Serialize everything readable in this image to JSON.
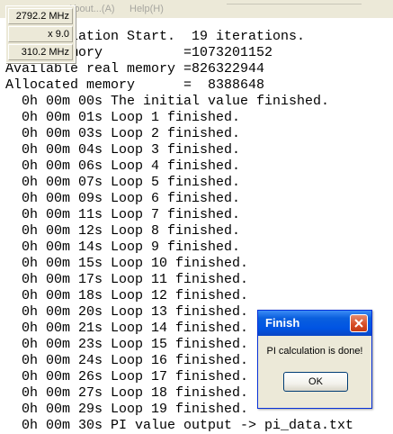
{
  "menubar": {
    "about_label": "About...(A)",
    "help_label": "Help(H)"
  },
  "cpu_meter": {
    "clock": "2792.2 MHz",
    "multiplier": "x 9.0",
    "bus": "310.2 MHz"
  },
  "console": {
    "lines": [
      "Pi calculation Start.  19 iterations.",
      "Total memory          =1073201152",
      "Available real memory =826322944",
      "Allocated memory      =  8388648",
      "  0h 00m 00s The initial value finished.",
      "  0h 00m 01s Loop 1 finished.",
      "  0h 00m 03s Loop 2 finished.",
      "  0h 00m 04s Loop 3 finished.",
      "  0h 00m 06s Loop 4 finished.",
      "  0h 00m 07s Loop 5 finished.",
      "  0h 00m 09s Loop 6 finished.",
      "  0h 00m 11s Loop 7 finished.",
      "  0h 00m 12s Loop 8 finished.",
      "  0h 00m 14s Loop 9 finished.",
      "  0h 00m 15s Loop 10 finished.",
      "  0h 00m 17s Loop 11 finished.",
      "  0h 00m 18s Loop 12 finished.",
      "  0h 00m 20s Loop 13 finished.",
      "  0h 00m 21s Loop 14 finished.",
      "  0h 00m 23s Loop 15 finished.",
      "  0h 00m 24s Loop 16 finished.",
      "  0h 00m 26s Loop 17 finished.",
      "  0h 00m 27s Loop 18 finished.",
      "  0h 00m 29s Loop 19 finished.",
      "  0h 00m 30s PI value output -> pi_data.txt"
    ]
  },
  "dialog": {
    "title": "Finish",
    "message": "PI calculation is done!",
    "ok_label": "OK"
  }
}
